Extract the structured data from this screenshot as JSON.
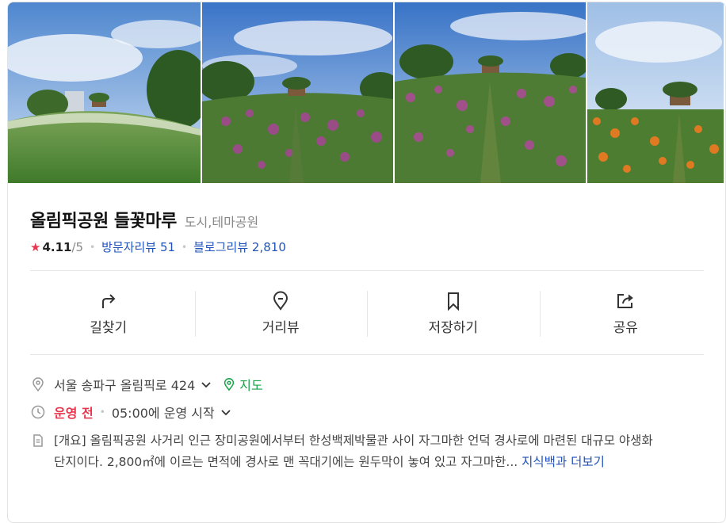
{
  "place": {
    "name": "올림픽공원 들꽃마루",
    "category": "도시,테마공원",
    "rating": "4.11",
    "rating_max": "/5",
    "visitor_review_label": "방문자리뷰",
    "visitor_review_count": "51",
    "blog_review_label": "블로그리뷰",
    "blog_review_count": "2,810"
  },
  "actions": [
    {
      "label": "길찾기",
      "icon": "directions-icon"
    },
    {
      "label": "거리뷰",
      "icon": "location-pin-icon"
    },
    {
      "label": "저장하기",
      "icon": "bookmark-icon"
    },
    {
      "label": "공유",
      "icon": "share-icon"
    }
  ],
  "address": {
    "text": "서울 송파구 올림픽로 424",
    "map_label": "지도"
  },
  "hours": {
    "status": "운영 전",
    "detail": "05:00에 운영 시작"
  },
  "description": {
    "text": "[개요] 올림픽공원 사거리 인근 장미공원에서부터 한성백제박물관 사이 자그마한 언덕 경사로에 마련된 대규모 야생화 단지이다. 2,800㎡에 이르는 면적에 경사로 맨 꼭대기에는 원두막이 놓여 있고 자그마한...",
    "more_label": "지식백과 더보기"
  },
  "colors": {
    "accent_link": "#2153b9",
    "status_red": "#e8364f",
    "map_green": "#1aa34a"
  }
}
